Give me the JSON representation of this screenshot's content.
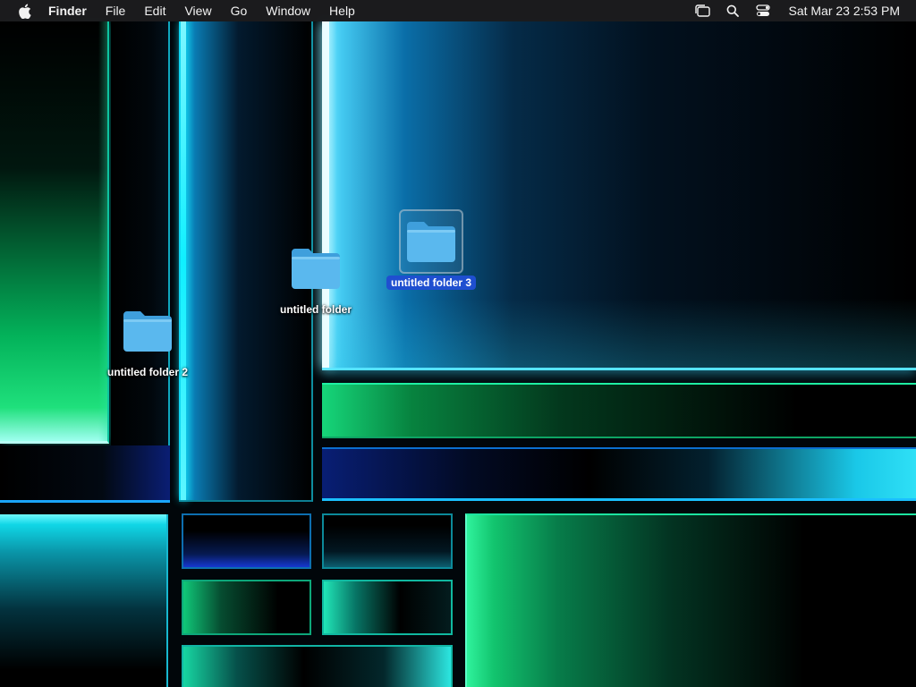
{
  "menubar": {
    "apple_icon": "apple-logo-icon",
    "app_name": "Finder",
    "items": [
      "File",
      "Edit",
      "View",
      "Go",
      "Window",
      "Help"
    ],
    "status_icons": [
      "stage-manager-icon",
      "spotlight-search-icon",
      "control-center-icon"
    ],
    "clock": "Sat Mar 23  2:53 PM"
  },
  "desktop": {
    "icons": [
      {
        "label": "untitled folder 3",
        "icon": "folder-icon",
        "selected": true
      },
      {
        "label": "untitled folder",
        "icon": "folder-icon",
        "selected": false
      },
      {
        "label": "untitled folder 2",
        "icon": "folder-icon",
        "selected": false
      }
    ]
  },
  "colors": {
    "menubar_bg": "#1c1c1e",
    "folder_blue": "#5ab8ee",
    "selection_blue": "#1f4fd0"
  }
}
